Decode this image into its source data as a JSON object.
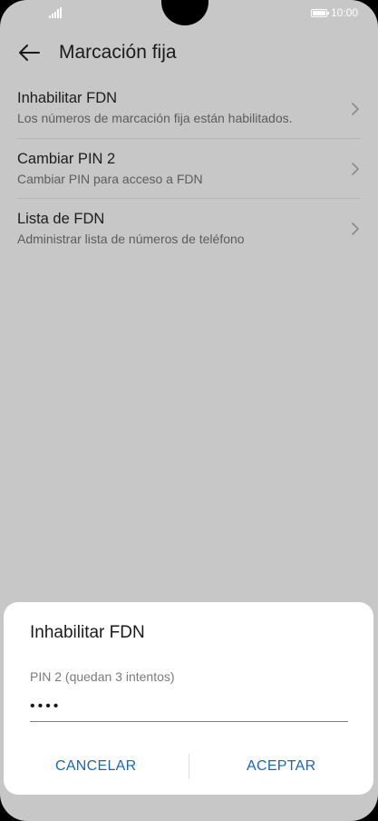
{
  "status_bar": {
    "time": "10:00"
  },
  "header": {
    "title": "Marcación fija"
  },
  "list": {
    "items": [
      {
        "title": "Inhabilitar FDN",
        "subtitle": "Los números de marcación fija están habilitados."
      },
      {
        "title": "Cambiar PIN 2",
        "subtitle": "Cambiar PIN para acceso a FDN"
      },
      {
        "title": "Lista de FDN",
        "subtitle": "Administrar lista de números de teléfono"
      }
    ]
  },
  "dialog": {
    "title": "Inhabilitar FDN",
    "field_label": "PIN 2 (quedan 3 intentos)",
    "field_value": "••••",
    "cancel_label": "CANCELAR",
    "accept_label": "ACEPTAR"
  },
  "colors": {
    "background": "#c7c7c7",
    "dialog_background": "#ffffff",
    "accent": "#1768b8"
  }
}
